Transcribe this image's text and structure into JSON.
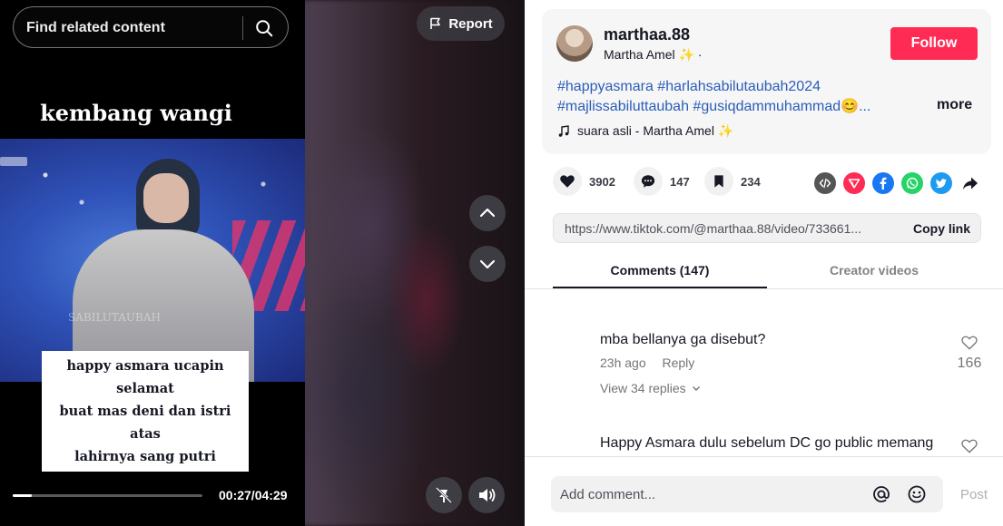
{
  "search": {
    "placeholder": "Find related content"
  },
  "video": {
    "report_label": "Report",
    "frame_title": "kembang wangi",
    "caption_lines": [
      "happy asmara ucapin selamat",
      "buat mas deni dan istri atas",
      "lahirnya sang putri"
    ],
    "watermark": "SABILUTAUBAH",
    "time": "00:27/04:29",
    "progress": 0.1
  },
  "author": {
    "username": "marthaa.88",
    "nickname": "Martha Amel ✨ ·",
    "follow_label": "Follow"
  },
  "description": {
    "line1": "#happyasmara #harlahsabilutaubah2024",
    "line2": "#majlissabiluttaubah #gusiqdammuhammad😊...",
    "more_label": "more",
    "music": "suara asli - Martha Amel ✨"
  },
  "stats": {
    "likes": "3902",
    "comments": "147",
    "saves": "234"
  },
  "share_icons": [
    "embed-icon",
    "send-icon",
    "facebook-icon",
    "whatsapp-icon",
    "twitter-icon",
    "share-arrow-icon"
  ],
  "colors": {
    "follow": "#fe2c55",
    "hashtag": "#2b5db9",
    "facebook": "#1877f2",
    "whatsapp": "#25d366",
    "twitter": "#1d9bf0",
    "send": "#fe2c55"
  },
  "link": {
    "url": "https://www.tiktok.com/@marthaa.88/video/733661...",
    "copy_label": "Copy link"
  },
  "tabs": {
    "comments": "Comments (147)",
    "creator": "Creator videos"
  },
  "comments": [
    {
      "text": "mba bellanya ga disebut?",
      "time": "23h ago",
      "reply": "Reply",
      "likes": "166",
      "view_replies": "View 34 replies"
    },
    {
      "text": "Happy Asmara dulu sebelum DC go public memang"
    }
  ],
  "footer": {
    "placeholder": "Add comment...",
    "post_label": "Post"
  }
}
